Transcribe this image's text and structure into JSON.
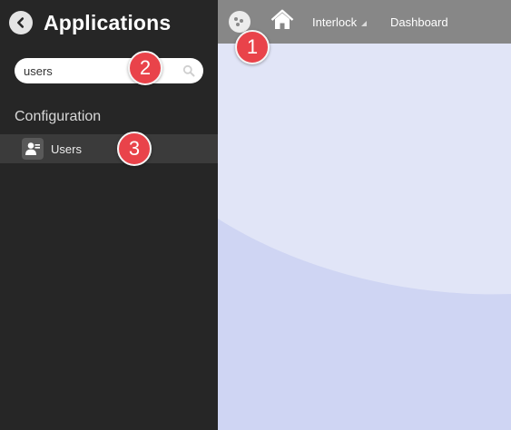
{
  "sidebar": {
    "title": "Applications",
    "search": {
      "value": "users",
      "placeholder": ""
    },
    "section_label": "Configuration",
    "items": [
      {
        "label": "Users",
        "icon": "users-icon"
      }
    ]
  },
  "topbar": {
    "menu_icon": "apps-menu-icon",
    "home_icon": "home-icon",
    "breadcrumb": {
      "site": "Interlock",
      "page": "Dashboard"
    }
  },
  "annotations": [
    "1",
    "2",
    "3"
  ],
  "colors": {
    "sidebar_bg": "#262626",
    "topbar_bg": "#878787",
    "content_light": "#e1e5f7",
    "content_dark": "#cfd5f3",
    "badge": "#e9434a"
  }
}
